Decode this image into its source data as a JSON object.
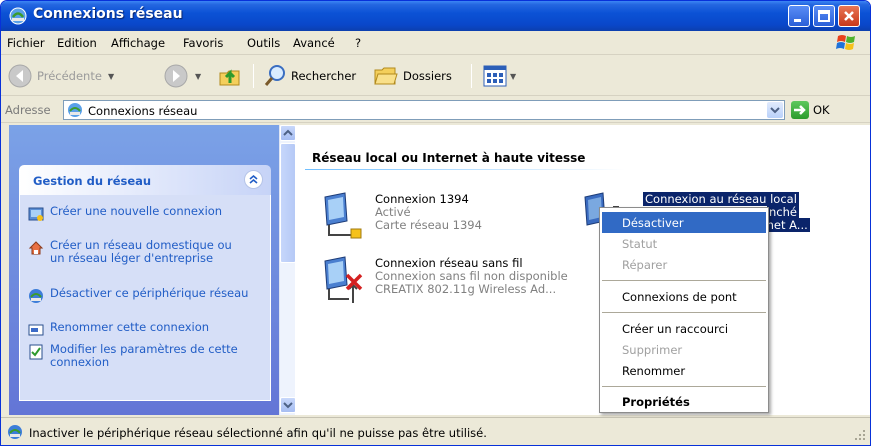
{
  "window": {
    "title": "Connexions réseau"
  },
  "menu": [
    "Fichier",
    "Edition",
    "Affichage",
    "Favoris",
    "Outils",
    "Avancé",
    "?"
  ],
  "toolbar": {
    "back": "Précédente",
    "search": "Rechercher",
    "folders": "Dossiers"
  },
  "address": {
    "label": "Adresse",
    "value": "Connexions réseau",
    "go": "OK"
  },
  "tasks": {
    "header": "Gestion du réseau",
    "items": [
      {
        "label": "Créer une nouvelle connexion",
        "icon": "new-connection-icon"
      },
      {
        "label": "Créer un réseau domestique ou un réseau léger d'entreprise",
        "icon": "home-network-icon"
      },
      {
        "label": "Désactiver ce périphérique réseau",
        "icon": "disable-device-icon"
      },
      {
        "label": "Renommer cette connexion",
        "icon": "rename-icon"
      },
      {
        "label": "Modifier les paramètres de cette connexion",
        "icon": "settings-icon"
      }
    ]
  },
  "group": {
    "header": "Réseau local ou Internet à haute vitesse"
  },
  "connections": [
    {
      "name": "Connexion 1394",
      "status": "Activé",
      "device": "Carte réseau 1394"
    },
    {
      "name": "Connexion réseau sans fil",
      "status": "Connexion sans fil non disponible",
      "device": "CREATIX 802.11g Wireless Ad..."
    },
    {
      "name": "Connexion au réseau local",
      "status": "nché",
      "device": "ernet A..."
    }
  ],
  "context_menu": {
    "items": [
      {
        "label": "Désactiver",
        "state": "highlighted"
      },
      {
        "label": "Statut",
        "state": "disabled"
      },
      {
        "label": "Réparer",
        "state": "disabled"
      },
      {
        "label": "Connexions de pont",
        "state": "normal"
      },
      {
        "label": "Créer un raccourci",
        "state": "normal"
      },
      {
        "label": "Supprimer",
        "state": "disabled"
      },
      {
        "label": "Renommer",
        "state": "normal"
      },
      {
        "label": "Propriétés",
        "state": "default"
      }
    ]
  },
  "status": {
    "text": "Inactiver le périphérique réseau sélectionné afin qu'il ne puisse pas être utilisé."
  },
  "colors": {
    "titlebar": "#0a47c9",
    "selection": "#316ac5",
    "link": "#215dc6",
    "taskpane": "#6375d6"
  }
}
